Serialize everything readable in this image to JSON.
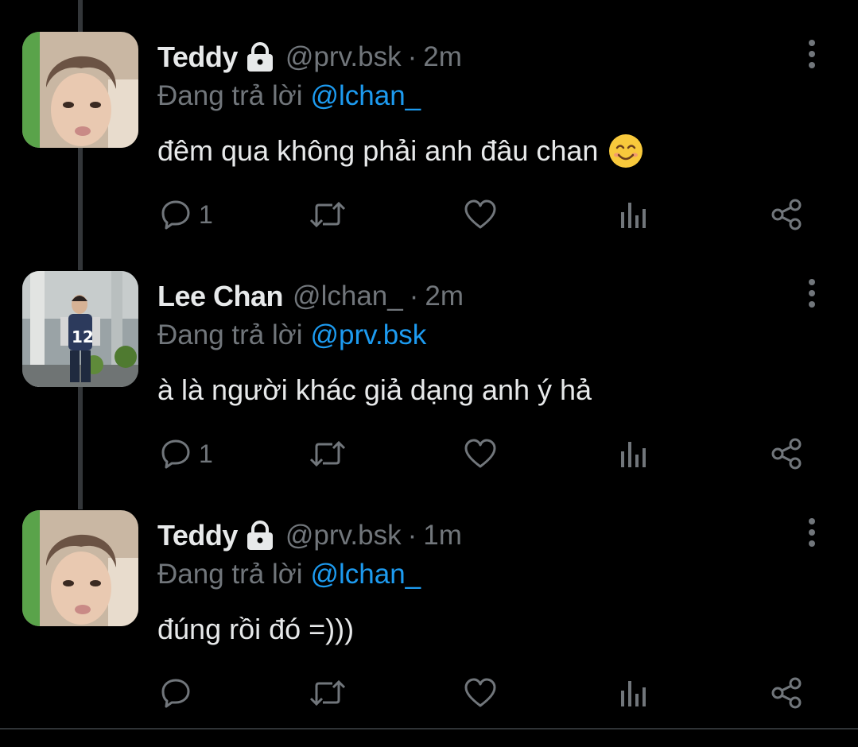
{
  "colors": {
    "background": "#000000",
    "text_primary": "#e7e9ea",
    "text_secondary": "#71767b",
    "accent": "#1d9bf0",
    "thread_line": "#333639"
  },
  "tweets": [
    {
      "name": "Teddy",
      "protected": true,
      "handle": "@prv.bsk",
      "separator": "·",
      "time": "2m",
      "reply_prefix": "Đang trả lời",
      "reply_to": "@lchan_",
      "text": "đêm qua không phải anh đâu chan",
      "emoji": "smiling-face-emoji",
      "reply_count": "1",
      "retweet_count": "",
      "like_count": "",
      "avatar": "portrait-boy-avatar"
    },
    {
      "name": "Lee Chan",
      "protected": false,
      "handle": "@lchan_",
      "separator": "·",
      "time": "2m",
      "reply_prefix": "Đang trả lời",
      "reply_to": "@prv.bsk",
      "text": "à là người khác giả dạng anh ý hả",
      "emoji": "",
      "reply_count": "1",
      "retweet_count": "",
      "like_count": "",
      "avatar": "standing-jersey-photo-avatar"
    },
    {
      "name": "Teddy",
      "protected": true,
      "handle": "@prv.bsk",
      "separator": "·",
      "time": "1m",
      "reply_prefix": "Đang trả lời",
      "reply_to": "@lchan_",
      "text": "đúng rồi đó =)))",
      "emoji": "",
      "reply_count": "",
      "retweet_count": "",
      "like_count": "",
      "avatar": "portrait-boy-avatar"
    }
  ],
  "icons": [
    "lock-icon",
    "more-icon",
    "reply-icon",
    "retweet-icon",
    "like-icon",
    "views-icon",
    "share-icon",
    "smiling-face-emoji"
  ]
}
